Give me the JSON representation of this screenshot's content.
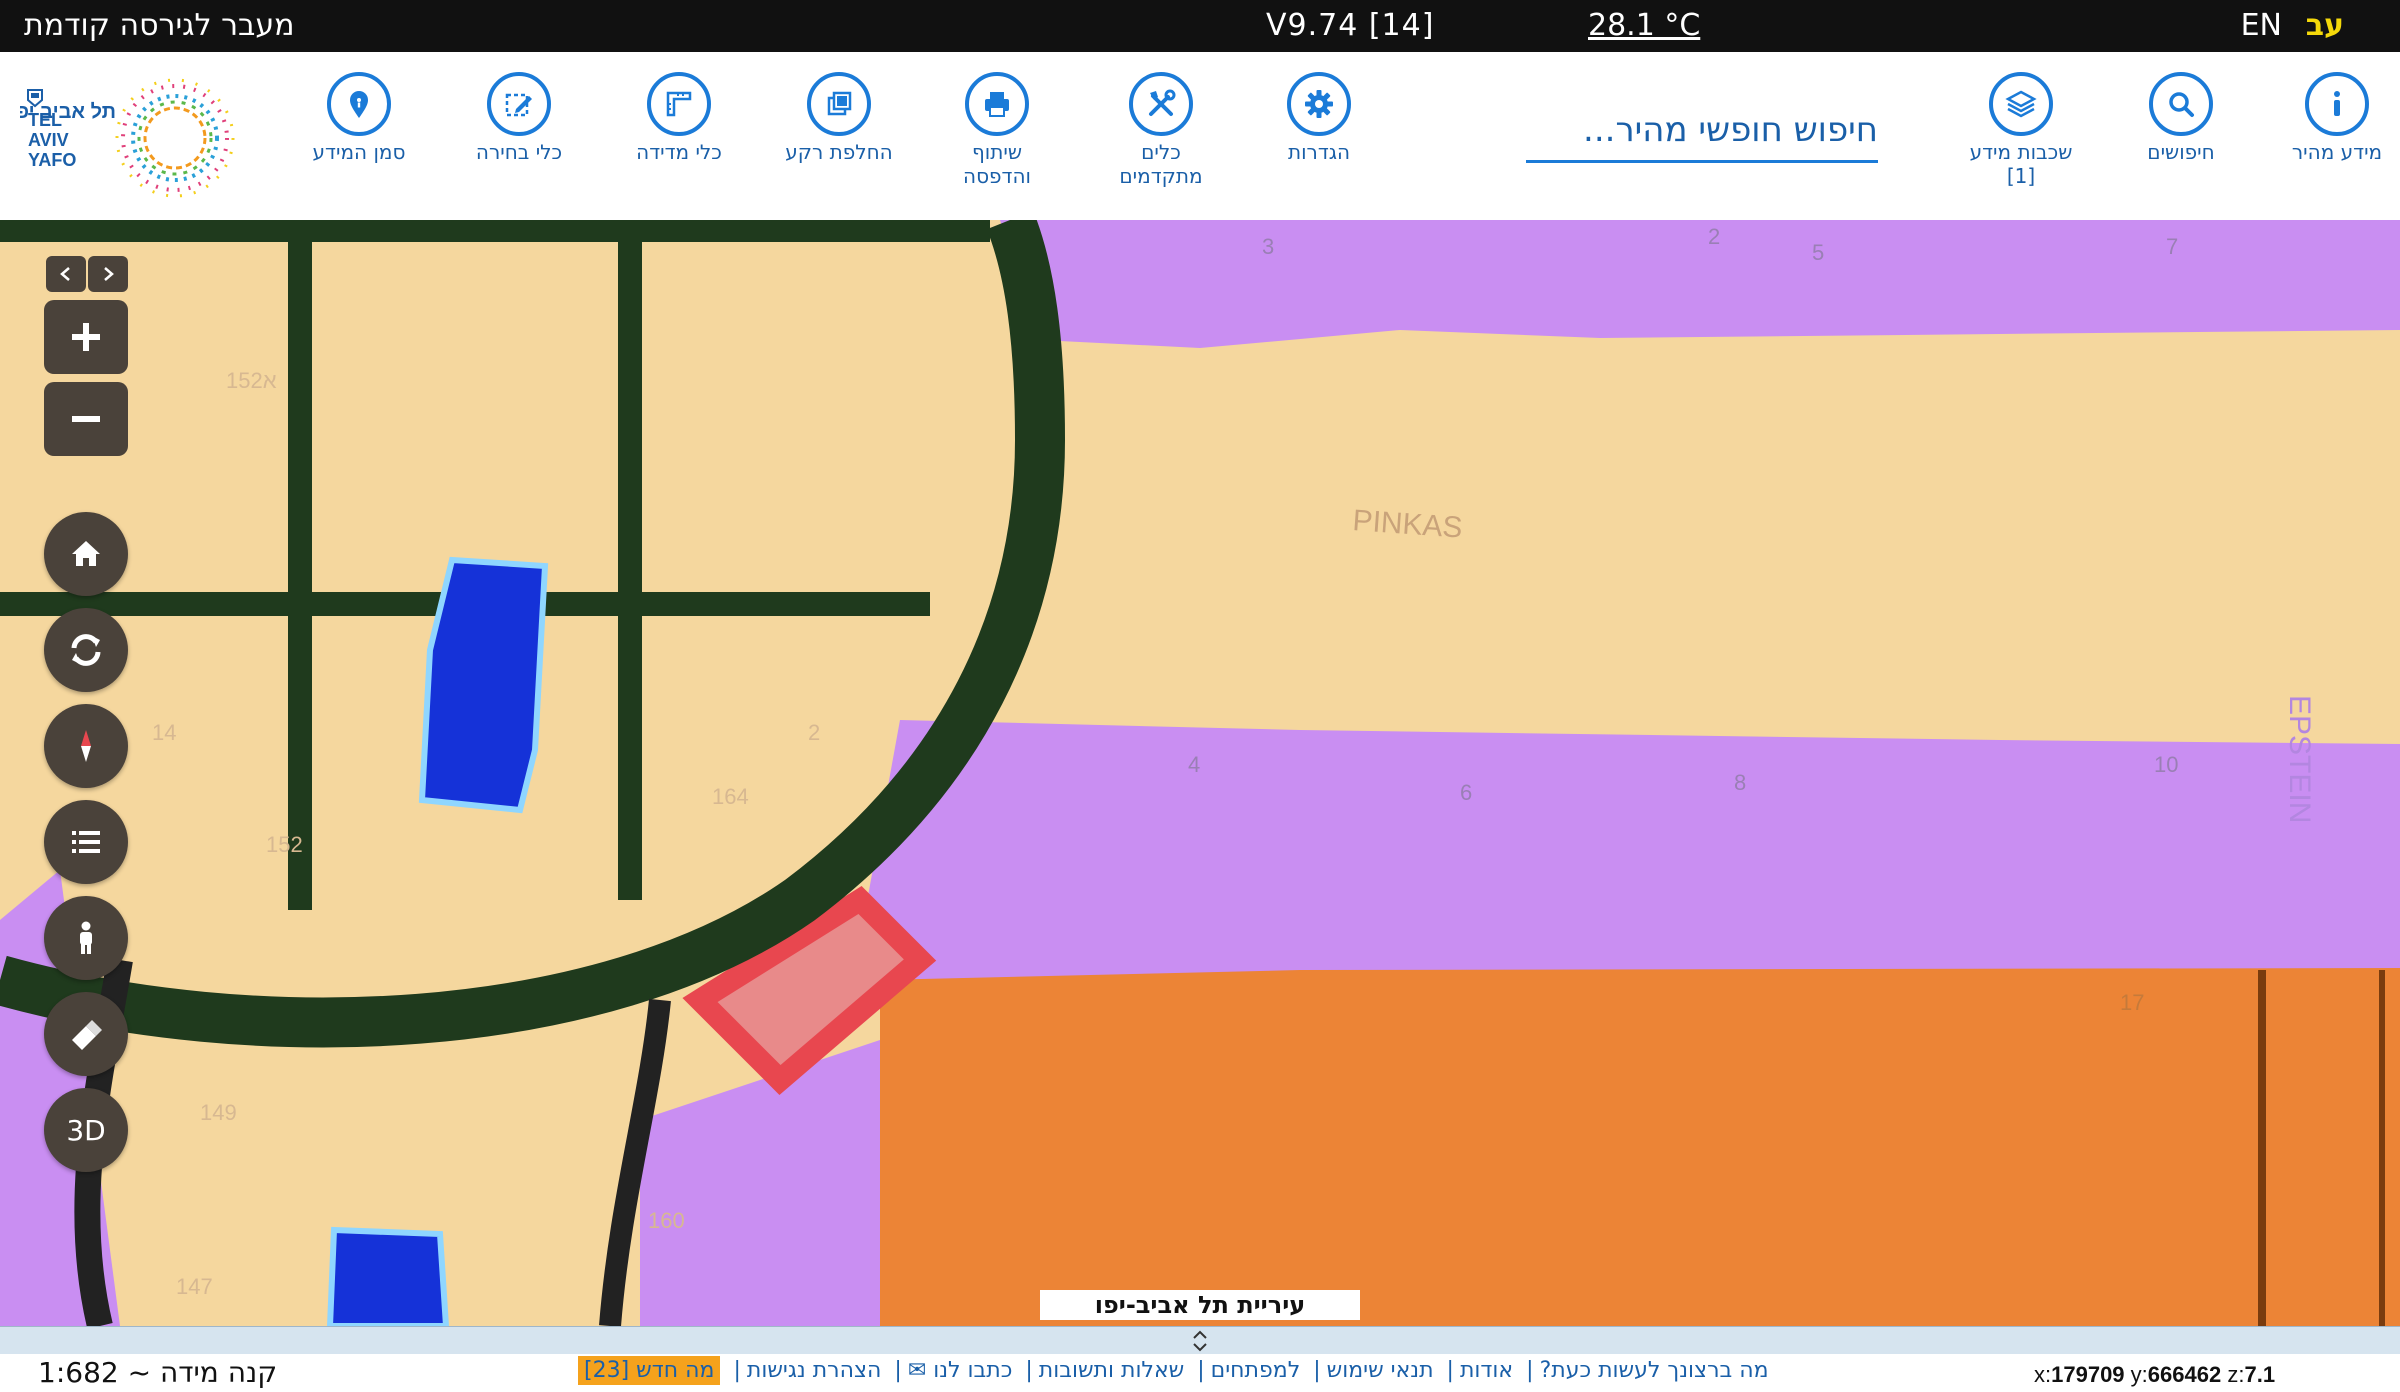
{
  "topbar": {
    "lang_he": "עב",
    "lang_en": "EN",
    "temperature": "28.1 °C",
    "version": "V9.74 [14]",
    "prev_version_link": "מעבר לגירסה קודמת"
  },
  "toolbar": {
    "quick_info": "מידע מהיר",
    "searches": "חיפושים",
    "layers": "שכבות מידע",
    "layers_count": "[1]",
    "search_placeholder": "חיפוש חופשי מהיר...",
    "settings": "הגדרות",
    "advanced_tools_1": "כלים",
    "advanced_tools_2": "מתקדמים",
    "share_print_1": "שיתוף",
    "share_print_2": "והדפסה",
    "background_switch": "החלפת רקע",
    "measure_tools": "כלי מדידה",
    "selection_tools": "כלי בחירה",
    "info_marker": "סמן המידע"
  },
  "logo": {
    "text_he": "תל אביב יפו",
    "text_en_1": "TEL",
    "text_en_2": "AVIV",
    "text_en_3": "YAFO"
  },
  "map": {
    "city_label": "עיריית תל אביב-יפו",
    "street_pinkas": "PINKAS",
    "street_epstein": "EPSTEIN",
    "parcel_numbers": [
      "3",
      "2",
      "5",
      "7",
      "4",
      "6",
      "8",
      "10",
      "17",
      "14",
      "2",
      "164",
      "152",
      "152א",
      "149",
      "147",
      "160"
    ],
    "control_3d": "3D"
  },
  "status": {
    "scale": "קנה מידה ~ 1:682",
    "link_whats_new": "מה חדש [23]",
    "link_accessibility": "הצהרת נגישות",
    "link_contact": "כתבו לנו ✉",
    "link_faq": "שאלות ותשובות",
    "link_developers": "למפתחים",
    "link_terms": "תנאי שימוש",
    "link_about": "אודות",
    "link_what_to_do": "מה ברצונך לעשות כעת?",
    "coord_x_label": "x:",
    "coord_x": "179709",
    "coord_y_label": "y:",
    "coord_y": "666462",
    "coord_z_label": "z:",
    "coord_z": "7.1"
  },
  "colors": {
    "accent_blue": "#1b7bd8",
    "topbar_bg": "#111111",
    "lang_active": "#f5d90a",
    "residential": "#f5d79e",
    "public": "#c98ef2",
    "commercial": "#ec8436",
    "park_ring": "#1f3a1d",
    "water": "#1532d8",
    "whats_new_bg": "#f5a21c"
  }
}
